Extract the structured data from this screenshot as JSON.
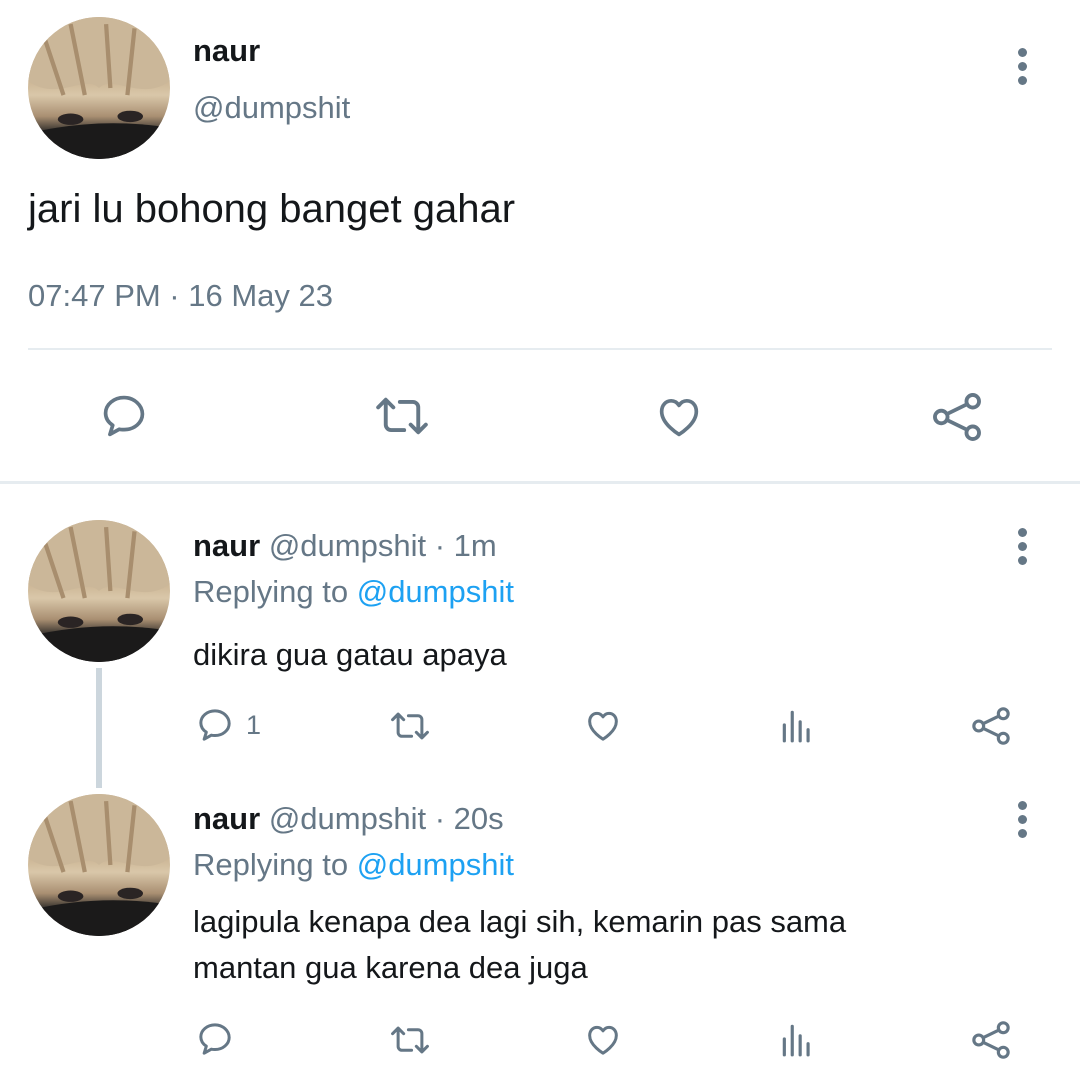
{
  "main_tweet": {
    "display_name": "naur",
    "handle": "@dumpshit",
    "text": "jari lu bohong banget gahar",
    "timestamp": "07:47 PM · 16 May 23",
    "actions": [
      "reply-icon",
      "retweet-icon",
      "like-icon",
      "share-icon"
    ]
  },
  "replies": [
    {
      "display_name": "naur",
      "handle": "@dumpshit",
      "separator": "·",
      "time": "1m",
      "replying_prefix": "Replying to",
      "replying_to": "@dumpshit",
      "text_lines": [
        "dikira gua gatau apaya"
      ],
      "reply_count": "1"
    },
    {
      "display_name": "naur",
      "handle": "@dumpshit",
      "separator": "·",
      "time": "20s",
      "replying_prefix": "Replying to",
      "replying_to": "@dumpshit",
      "text_lines": [
        "lagipula kenapa dea lagi sih, kemarin pas sama",
        "mantan gua karena dea juga"
      ],
      "reply_count": ""
    }
  ],
  "colors": {
    "text": "#14171a",
    "secondary": "#657786",
    "link": "#1da1f2",
    "divider": "#e6ecf0"
  }
}
